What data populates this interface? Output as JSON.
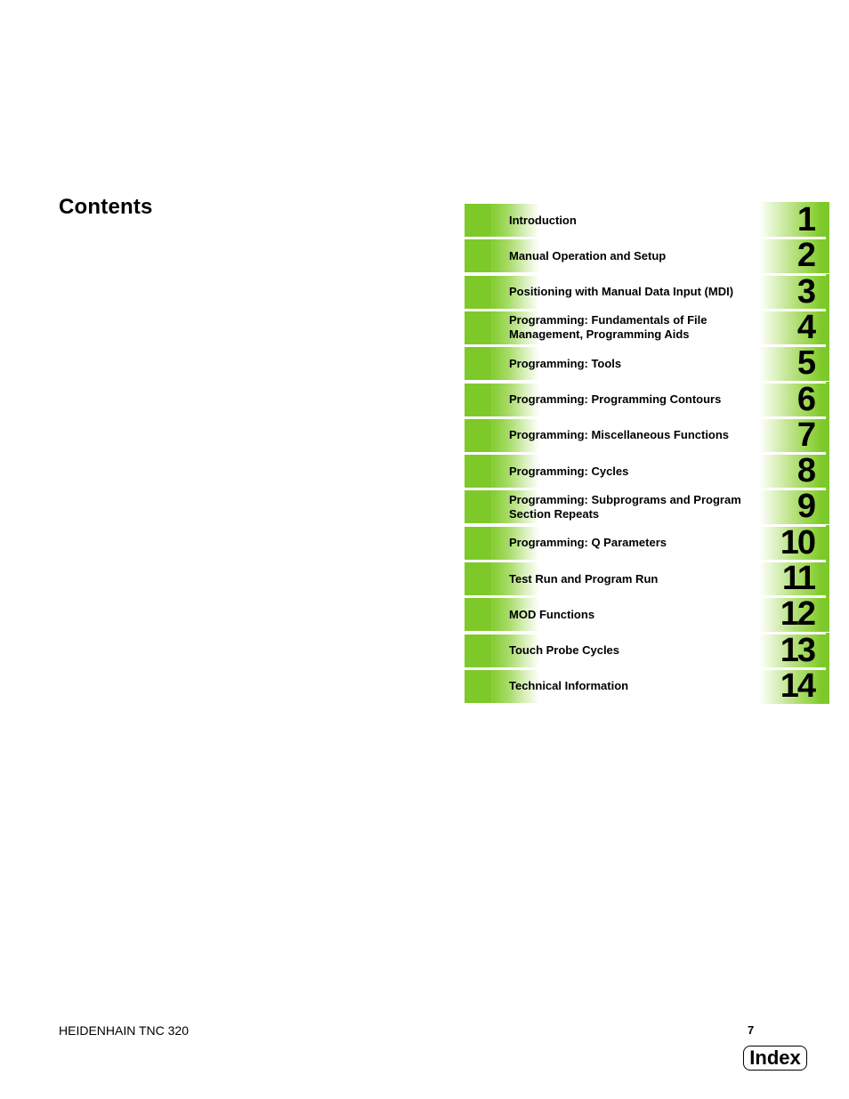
{
  "page": {
    "title": "Contents",
    "footer_title": "HEIDENHAIN TNC 320",
    "page_number": "7",
    "index_label": "Index",
    "accent_color": "#7dc92a"
  },
  "toc": [
    {
      "number": "1",
      "label": "Introduction"
    },
    {
      "number": "2",
      "label": "Manual Operation and Setup"
    },
    {
      "number": "3",
      "label": "Positioning with Manual Data Input (MDI)"
    },
    {
      "number": "4",
      "label": "Programming: Fundamentals of File Management, Programming Aids"
    },
    {
      "number": "5",
      "label": "Programming: Tools"
    },
    {
      "number": "6",
      "label": "Programming: Programming Contours"
    },
    {
      "number": "7",
      "label": "Programming: Miscellaneous Functions"
    },
    {
      "number": "8",
      "label": "Programming: Cycles"
    },
    {
      "number": "9",
      "label": "Programming: Subprograms and Program Section Repeats"
    },
    {
      "number": "10",
      "label": "Programming: Q Parameters"
    },
    {
      "number": "11",
      "label": "Test Run and Program Run"
    },
    {
      "number": "12",
      "label": "MOD Functions"
    },
    {
      "number": "13",
      "label": "Touch Probe Cycles"
    },
    {
      "number": "14",
      "label": "Technical Information"
    }
  ]
}
